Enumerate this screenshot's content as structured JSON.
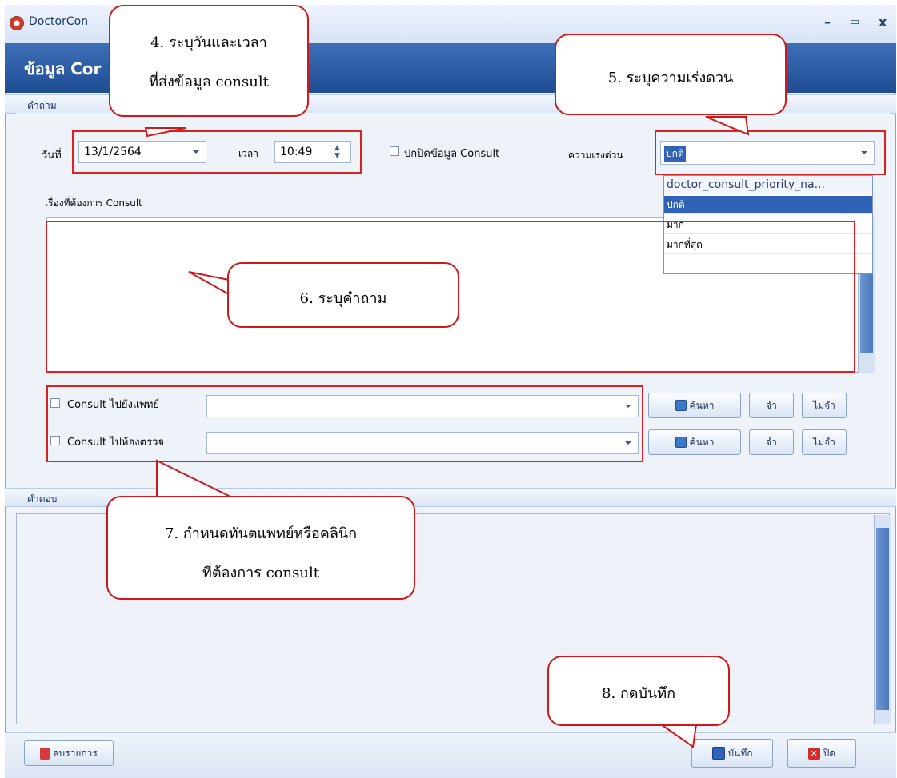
{
  "window": {
    "title": "DoctorCon",
    "minimize": "–",
    "maximize": "▭",
    "close": "x"
  },
  "header": {
    "title": "ข้อมูล Cor"
  },
  "question_group": {
    "label": "คำถาม"
  },
  "answer_group": {
    "label": "คำตอบ"
  },
  "date": {
    "label": "วันที่",
    "value": "13/1/2564"
  },
  "time": {
    "label": "เวลา",
    "value": "10:49"
  },
  "hide_checkbox": {
    "label": "ปกปิดข้อมูล Consult"
  },
  "priority": {
    "label": "ความเร่งด่วน",
    "value": "ปกติ",
    "header": "doctor_consult_priority_na...",
    "options": [
      "ปกติ",
      "มาก",
      "มากที่สุด"
    ]
  },
  "topic": {
    "label": "เรื่องที่ต้องการ Consult"
  },
  "consult_doctor": {
    "label": "Consult ไปยังแพทย์",
    "search": "ค้นหา",
    "remember": "จำ",
    "forget": "ไม่จำ"
  },
  "consult_room": {
    "label": "Consult ไปห้องตรวจ",
    "search": "ค้นหา",
    "remember": "จำ",
    "forget": "ไม่จำ"
  },
  "footer": {
    "delete": "ลบรายการ",
    "save": "บันทึก",
    "close": "ปิด"
  },
  "callouts": {
    "c4_line1": "4. ระบุวันและเวลา",
    "c4_line2": "ที่ส่งข้อมูล consult",
    "c5": "5. ระบุความเร่งดวน",
    "c6": "6. ระบุคำถาม",
    "c7_line1": "7. กำหนดทันตแพทย์หรือคลินิก",
    "c7_line2": "ที่ต้องการ consult",
    "c8": "8. กดบันทึก"
  },
  "colors": {
    "header": "#2a5aa5",
    "annotation": "#e02020"
  }
}
